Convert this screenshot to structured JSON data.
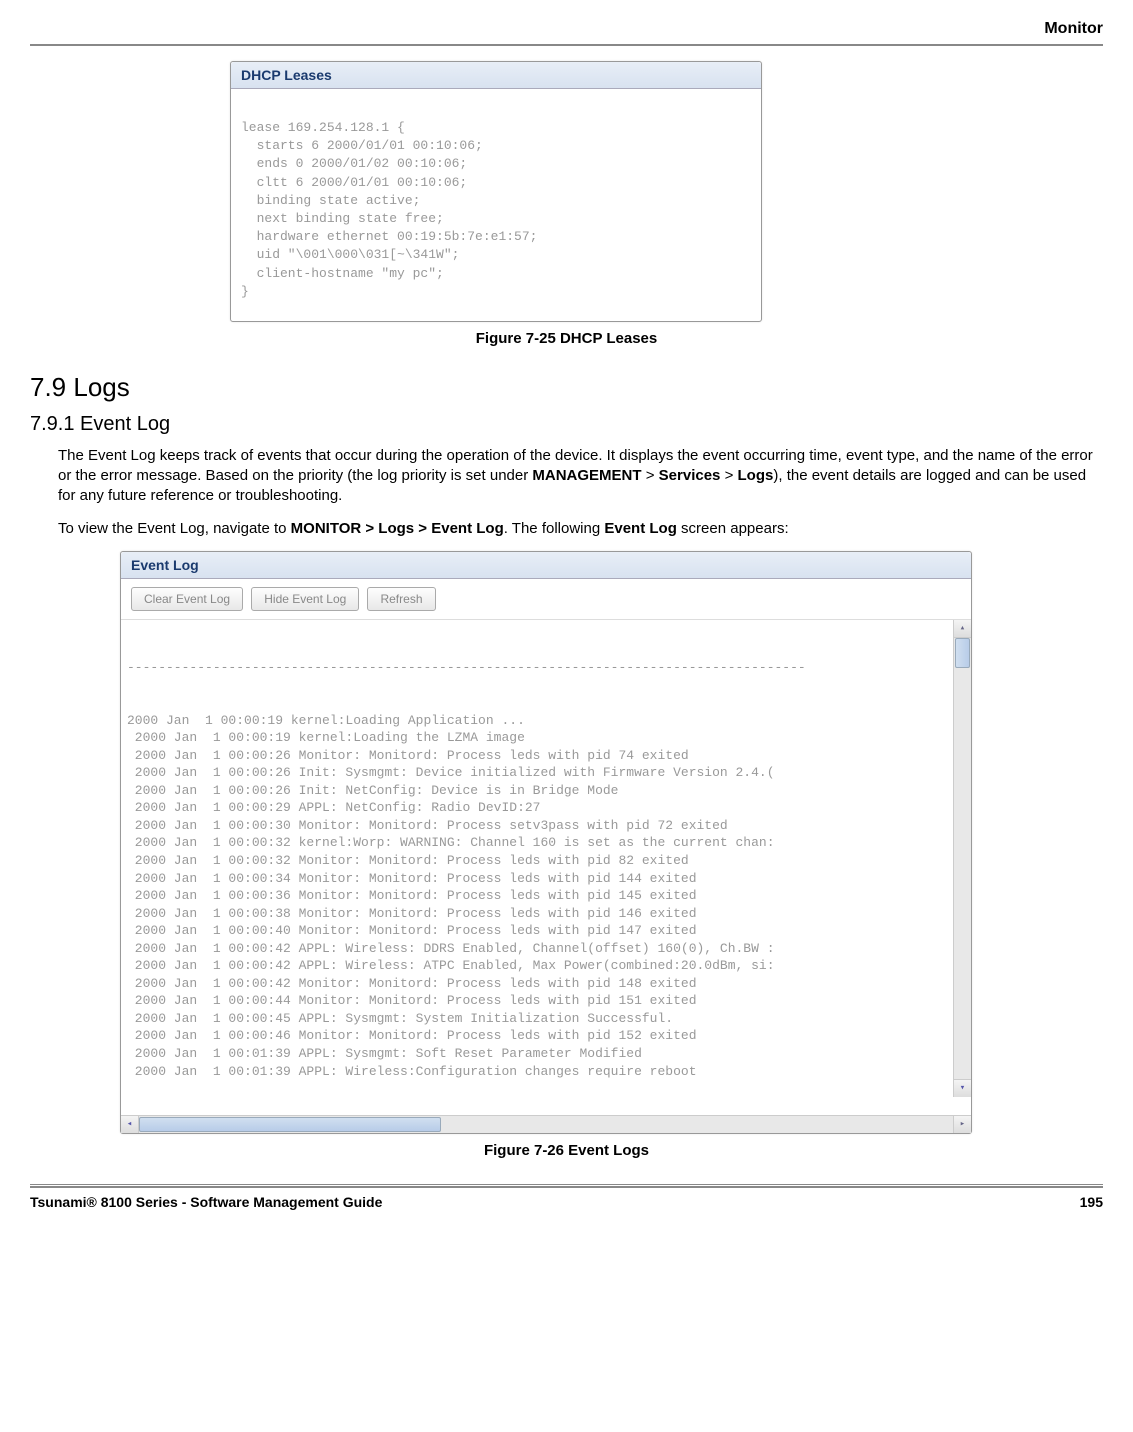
{
  "header": {
    "title": "Monitor"
  },
  "dhcp_panel": {
    "title": "DHCP Leases",
    "content": "lease 169.254.128.1 {\n  starts 6 2000/01/01 00:10:06;\n  ends 0 2000/01/02 00:10:06;\n  cltt 6 2000/01/01 00:10:06;\n  binding state active;\n  next binding state free;\n  hardware ethernet 00:19:5b:7e:e1:57;\n  uid \"\\001\\000\\031[~\\341W\";\n  client-hostname \"my pc\";\n}"
  },
  "figure1_caption": "Figure 7-25 DHCP Leases",
  "section_heading": "7.9 Logs",
  "subsection_heading": "7.9.1 Event Log",
  "para1_a": "The Event Log keeps track of events that occur during the operation of the device. It displays the event occurring time, event type, and the name of the error or the error message. Based on the priority (the log priority is set under ",
  "para1_b": "MANAGEMENT",
  "para1_c": " > ",
  "para1_d": "Services",
  "para1_e": " > ",
  "para1_f": "Logs",
  "para1_g": "), the event details are logged and can be used for any future reference or troubleshooting.",
  "para2_a": "To view the Event Log, navigate to ",
  "para2_b": "MONITOR > Logs > Event Log",
  "para2_c": ". The following ",
  "para2_d": "Event Log",
  "para2_e": " screen appears:",
  "eventlog_panel": {
    "title": "Event Log",
    "buttons": {
      "clear": "Clear Event Log",
      "hide": "Hide Event Log",
      "refresh": "Refresh"
    },
    "dashes": "---------------------------------------------------------------------------------------",
    "lines": [
      "2000 Jan  1 00:00:19 kernel:Loading Application ...",
      " 2000 Jan  1 00:00:19 kernel:Loading the LZMA image",
      " 2000 Jan  1 00:00:26 Monitor: Monitord: Process leds with pid 74 exited",
      " 2000 Jan  1 00:00:26 Init: Sysmgmt: Device initialized with Firmware Version 2.4.(",
      " 2000 Jan  1 00:00:26 Init: NetConfig: Device is in Bridge Mode",
      " 2000 Jan  1 00:00:29 APPL: NetConfig: Radio DevID:27",
      " 2000 Jan  1 00:00:30 Monitor: Monitord: Process setv3pass with pid 72 exited",
      " 2000 Jan  1 00:00:32 kernel:Worp: WARNING: Channel 160 is set as the current chan:",
      " 2000 Jan  1 00:00:32 Monitor: Monitord: Process leds with pid 82 exited",
      " 2000 Jan  1 00:00:34 Monitor: Monitord: Process leds with pid 144 exited",
      " 2000 Jan  1 00:00:36 Monitor: Monitord: Process leds with pid 145 exited",
      " 2000 Jan  1 00:00:38 Monitor: Monitord: Process leds with pid 146 exited",
      " 2000 Jan  1 00:00:40 Monitor: Monitord: Process leds with pid 147 exited",
      " 2000 Jan  1 00:00:42 APPL: Wireless: DDRS Enabled, Channel(offset) 160(0), Ch.BW :",
      " 2000 Jan  1 00:00:42 APPL: Wireless: ATPC Enabled, Max Power(combined:20.0dBm, si:",
      " 2000 Jan  1 00:00:42 Monitor: Monitord: Process leds with pid 148 exited",
      " 2000 Jan  1 00:00:44 Monitor: Monitord: Process leds with pid 151 exited",
      " 2000 Jan  1 00:00:45 APPL: Sysmgmt: System Initialization Successful.",
      " 2000 Jan  1 00:00:46 Monitor: Monitord: Process leds with pid 152 exited",
      " 2000 Jan  1 00:01:39 APPL: Sysmgmt: Soft Reset Parameter Modified",
      " 2000 Jan  1 00:01:39 APPL: Wireless:Configuration changes require reboot"
    ]
  },
  "figure2_caption": "Figure 7-26 Event Logs",
  "footer": {
    "left": "Tsunami® 8100 Series - Software Management Guide",
    "right": "195"
  }
}
